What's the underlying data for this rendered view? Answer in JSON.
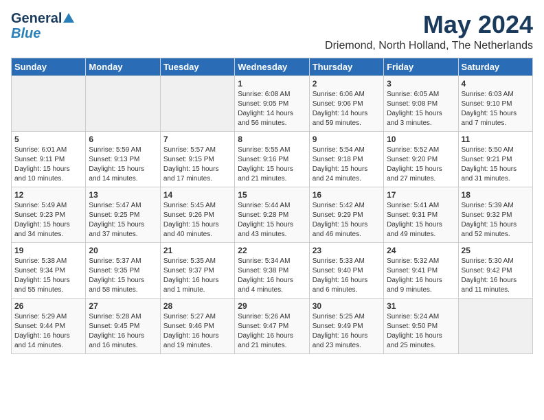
{
  "logo": {
    "line1": "General",
    "line2": "Blue"
  },
  "title": "May 2024",
  "location": "Driemond, North Holland, The Netherlands",
  "weekdays": [
    "Sunday",
    "Monday",
    "Tuesday",
    "Wednesday",
    "Thursday",
    "Friday",
    "Saturday"
  ],
  "weeks": [
    [
      {
        "day": "",
        "info": ""
      },
      {
        "day": "",
        "info": ""
      },
      {
        "day": "",
        "info": ""
      },
      {
        "day": "1",
        "info": "Sunrise: 6:08 AM\nSunset: 9:05 PM\nDaylight: 14 hours\nand 56 minutes."
      },
      {
        "day": "2",
        "info": "Sunrise: 6:06 AM\nSunset: 9:06 PM\nDaylight: 14 hours\nand 59 minutes."
      },
      {
        "day": "3",
        "info": "Sunrise: 6:05 AM\nSunset: 9:08 PM\nDaylight: 15 hours\nand 3 minutes."
      },
      {
        "day": "4",
        "info": "Sunrise: 6:03 AM\nSunset: 9:10 PM\nDaylight: 15 hours\nand 7 minutes."
      }
    ],
    [
      {
        "day": "5",
        "info": "Sunrise: 6:01 AM\nSunset: 9:11 PM\nDaylight: 15 hours\nand 10 minutes."
      },
      {
        "day": "6",
        "info": "Sunrise: 5:59 AM\nSunset: 9:13 PM\nDaylight: 15 hours\nand 14 minutes."
      },
      {
        "day": "7",
        "info": "Sunrise: 5:57 AM\nSunset: 9:15 PM\nDaylight: 15 hours\nand 17 minutes."
      },
      {
        "day": "8",
        "info": "Sunrise: 5:55 AM\nSunset: 9:16 PM\nDaylight: 15 hours\nand 21 minutes."
      },
      {
        "day": "9",
        "info": "Sunrise: 5:54 AM\nSunset: 9:18 PM\nDaylight: 15 hours\nand 24 minutes."
      },
      {
        "day": "10",
        "info": "Sunrise: 5:52 AM\nSunset: 9:20 PM\nDaylight: 15 hours\nand 27 minutes."
      },
      {
        "day": "11",
        "info": "Sunrise: 5:50 AM\nSunset: 9:21 PM\nDaylight: 15 hours\nand 31 minutes."
      }
    ],
    [
      {
        "day": "12",
        "info": "Sunrise: 5:49 AM\nSunset: 9:23 PM\nDaylight: 15 hours\nand 34 minutes."
      },
      {
        "day": "13",
        "info": "Sunrise: 5:47 AM\nSunset: 9:25 PM\nDaylight: 15 hours\nand 37 minutes."
      },
      {
        "day": "14",
        "info": "Sunrise: 5:45 AM\nSunset: 9:26 PM\nDaylight: 15 hours\nand 40 minutes."
      },
      {
        "day": "15",
        "info": "Sunrise: 5:44 AM\nSunset: 9:28 PM\nDaylight: 15 hours\nand 43 minutes."
      },
      {
        "day": "16",
        "info": "Sunrise: 5:42 AM\nSunset: 9:29 PM\nDaylight: 15 hours\nand 46 minutes."
      },
      {
        "day": "17",
        "info": "Sunrise: 5:41 AM\nSunset: 9:31 PM\nDaylight: 15 hours\nand 49 minutes."
      },
      {
        "day": "18",
        "info": "Sunrise: 5:39 AM\nSunset: 9:32 PM\nDaylight: 15 hours\nand 52 minutes."
      }
    ],
    [
      {
        "day": "19",
        "info": "Sunrise: 5:38 AM\nSunset: 9:34 PM\nDaylight: 15 hours\nand 55 minutes."
      },
      {
        "day": "20",
        "info": "Sunrise: 5:37 AM\nSunset: 9:35 PM\nDaylight: 15 hours\nand 58 minutes."
      },
      {
        "day": "21",
        "info": "Sunrise: 5:35 AM\nSunset: 9:37 PM\nDaylight: 16 hours\nand 1 minute."
      },
      {
        "day": "22",
        "info": "Sunrise: 5:34 AM\nSunset: 9:38 PM\nDaylight: 16 hours\nand 4 minutes."
      },
      {
        "day": "23",
        "info": "Sunrise: 5:33 AM\nSunset: 9:40 PM\nDaylight: 16 hours\nand 6 minutes."
      },
      {
        "day": "24",
        "info": "Sunrise: 5:32 AM\nSunset: 9:41 PM\nDaylight: 16 hours\nand 9 minutes."
      },
      {
        "day": "25",
        "info": "Sunrise: 5:30 AM\nSunset: 9:42 PM\nDaylight: 16 hours\nand 11 minutes."
      }
    ],
    [
      {
        "day": "26",
        "info": "Sunrise: 5:29 AM\nSunset: 9:44 PM\nDaylight: 16 hours\nand 14 minutes."
      },
      {
        "day": "27",
        "info": "Sunrise: 5:28 AM\nSunset: 9:45 PM\nDaylight: 16 hours\nand 16 minutes."
      },
      {
        "day": "28",
        "info": "Sunrise: 5:27 AM\nSunset: 9:46 PM\nDaylight: 16 hours\nand 19 minutes."
      },
      {
        "day": "29",
        "info": "Sunrise: 5:26 AM\nSunset: 9:47 PM\nDaylight: 16 hours\nand 21 minutes."
      },
      {
        "day": "30",
        "info": "Sunrise: 5:25 AM\nSunset: 9:49 PM\nDaylight: 16 hours\nand 23 minutes."
      },
      {
        "day": "31",
        "info": "Sunrise: 5:24 AM\nSunset: 9:50 PM\nDaylight: 16 hours\nand 25 minutes."
      },
      {
        "day": "",
        "info": ""
      }
    ]
  ]
}
